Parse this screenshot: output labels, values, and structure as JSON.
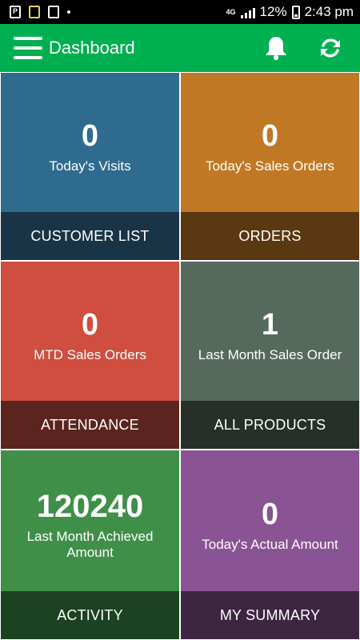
{
  "status_bar": {
    "left_icons": [
      "notification-p-icon",
      "battery-saver-icon",
      "screenshot-icon",
      "dot-icon"
    ],
    "network": "4G",
    "battery": "12%",
    "time": "2:43 pm"
  },
  "appbar": {
    "title": "Dashboard",
    "menu_icon": "hamburger-menu-icon",
    "notifications_icon": "bell-icon",
    "refresh_icon": "refresh-icon",
    "color": "#00b050"
  },
  "tiles": [
    {
      "value": "0",
      "label": "Today's Visits",
      "action": "CUSTOMER LIST",
      "top_color": "#2e6b8e",
      "bottom_color": "#1a3447"
    },
    {
      "value": "0",
      "label": "Today's Sales Orders",
      "action": "ORDERS",
      "top_color": "#c07825",
      "bottom_color": "#5a3812"
    },
    {
      "value": "0",
      "label": "MTD Sales Orders",
      "action": "ATTENDANCE",
      "top_color": "#cf4e3f",
      "bottom_color": "#5c241e"
    },
    {
      "value": "1",
      "label": "Last Month Sales Order",
      "action": "ALL PRODUCTS",
      "top_color": "#56695d",
      "bottom_color": "#263029"
    },
    {
      "value": "120240",
      "label": "Last Month Achieved Amount",
      "action": "ACTIVITY",
      "top_color": "#3f8f49",
      "bottom_color": "#1d4221"
    },
    {
      "value": "0",
      "label": "Today's Actual Amount",
      "action": "MY SUMMARY",
      "top_color": "#8a5393",
      "bottom_color": "#3e2643"
    }
  ]
}
